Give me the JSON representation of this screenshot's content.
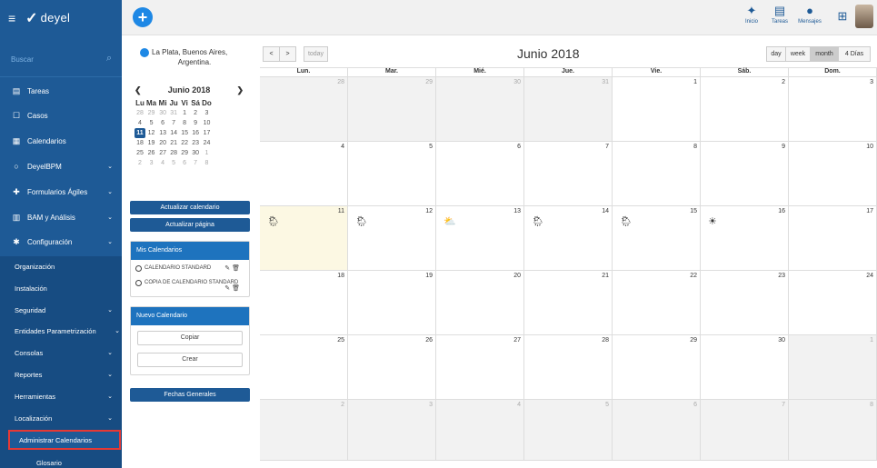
{
  "brand": {
    "logo_text": "deyel"
  },
  "topbar": {
    "inicio": "Inicio",
    "tareas": "Tareas",
    "mensajes": "Mensajes"
  },
  "colors": {
    "primary": "#1e5a96",
    "accent": "#1e88e5",
    "highlight": "#e53935",
    "today_bg": "#fcf8e3"
  },
  "sidebar": {
    "search_placeholder": "Buscar",
    "items": [
      {
        "label": "Tareas",
        "icon": "tasks-icon"
      },
      {
        "label": "Casos",
        "icon": "square-icon"
      },
      {
        "label": "Calendarios",
        "icon": "calendar-icon"
      },
      {
        "label": "DeyelBPM",
        "icon": "circle-icon"
      },
      {
        "label": "Formularios Ágiles",
        "icon": "forms-icon"
      },
      {
        "label": "BAM y Análisis",
        "icon": "chart-icon"
      },
      {
        "label": "Configuración",
        "icon": "gear-icon"
      }
    ],
    "submenu": [
      {
        "label": "Organización"
      },
      {
        "label": "Instalación"
      },
      {
        "label": "Seguridad"
      },
      {
        "label": "Entidades Parametrización"
      },
      {
        "label": "Consolas"
      },
      {
        "label": "Reportes"
      },
      {
        "label": "Herramientas"
      },
      {
        "label": "Localización"
      },
      {
        "label": "Administrar Calendarios"
      },
      {
        "label": "Glosario"
      }
    ]
  },
  "location": {
    "line1": "La Plata, Buenos Aires,",
    "line2": "Argentina."
  },
  "minical": {
    "title": "Junio 2018",
    "weekdays": [
      "Lu",
      "Ma",
      "Mi",
      "Ju",
      "Vi",
      "Sá",
      "Do"
    ],
    "weeks": [
      [
        "28",
        "29",
        "30",
        "31",
        "1",
        "2",
        "3"
      ],
      [
        "4",
        "5",
        "6",
        "7",
        "8",
        "9",
        "10"
      ],
      [
        "11",
        "12",
        "13",
        "14",
        "15",
        "16",
        "17"
      ],
      [
        "18",
        "19",
        "20",
        "21",
        "22",
        "23",
        "24"
      ],
      [
        "25",
        "26",
        "27",
        "28",
        "29",
        "30",
        "1"
      ],
      [
        "2",
        "3",
        "4",
        "5",
        "6",
        "7",
        "8"
      ]
    ]
  },
  "actions": {
    "update_calendar": "Actualizar calendario",
    "update_page": "Actualizar página"
  },
  "my_calendars": {
    "title": "Mis Calendarios",
    "items": [
      "CALENDARIO STANDARD",
      "COPIA DE CALENDARIO STANDARD"
    ]
  },
  "new_calendar": {
    "title": "Nuevo Calendario",
    "copy": "Copiar",
    "create": "Crear"
  },
  "general_dates": "Fechas Generales",
  "toolbar": {
    "prev": "<",
    "next": ">",
    "today": "today",
    "title": "Junio 2018",
    "views": [
      "day",
      "week",
      "month",
      "4 Días"
    ],
    "active_view": "month"
  },
  "calendar": {
    "day_headers": [
      "Lun.",
      "Mar.",
      "Mié.",
      "Jue.",
      "Vie.",
      "Sáb.",
      "Dom."
    ],
    "weeks": [
      [
        "28",
        "29",
        "30",
        "31",
        "1",
        "2",
        "3"
      ],
      [
        "4",
        "5",
        "6",
        "7",
        "8",
        "9",
        "10"
      ],
      [
        "11",
        "12",
        "13",
        "14",
        "15",
        "16",
        "17"
      ],
      [
        "18",
        "19",
        "20",
        "21",
        "22",
        "23",
        "24"
      ],
      [
        "25",
        "26",
        "27",
        "28",
        "29",
        "30",
        "1"
      ],
      [
        "2",
        "3",
        "4",
        "5",
        "6",
        "7",
        "8"
      ]
    ],
    "weather": {
      "11": "rain-sun-icon",
      "12": "rain-sun-icon",
      "13": "cloud-sun-icon",
      "14": "rain-sun-icon",
      "15": "rain-sun-icon",
      "16": "sun-icon"
    }
  }
}
